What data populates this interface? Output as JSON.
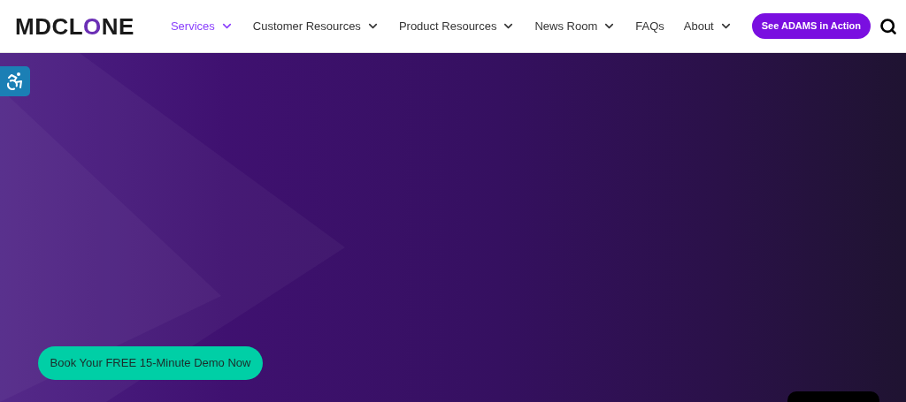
{
  "logo": {
    "parts": [
      {
        "text": "MDCL",
        "accent": false
      },
      {
        "text": "O",
        "accent": true
      },
      {
        "text": "NE",
        "accent": false
      }
    ]
  },
  "nav": [
    {
      "label": "Services",
      "selected": true,
      "dropdown": true
    },
    {
      "label": "Customer Resources",
      "selected": false,
      "dropdown": true
    },
    {
      "label": "Product Resources",
      "selected": false,
      "dropdown": true
    },
    {
      "label": "News Room",
      "selected": false,
      "dropdown": true
    },
    {
      "label": "FAQs",
      "selected": false,
      "dropdown": false
    },
    {
      "label": "About",
      "selected": false,
      "dropdown": true
    }
  ],
  "cta": "See ADAMS in Action",
  "hero": {
    "button": "Book Your FREE 15-Minute Demo Now"
  }
}
